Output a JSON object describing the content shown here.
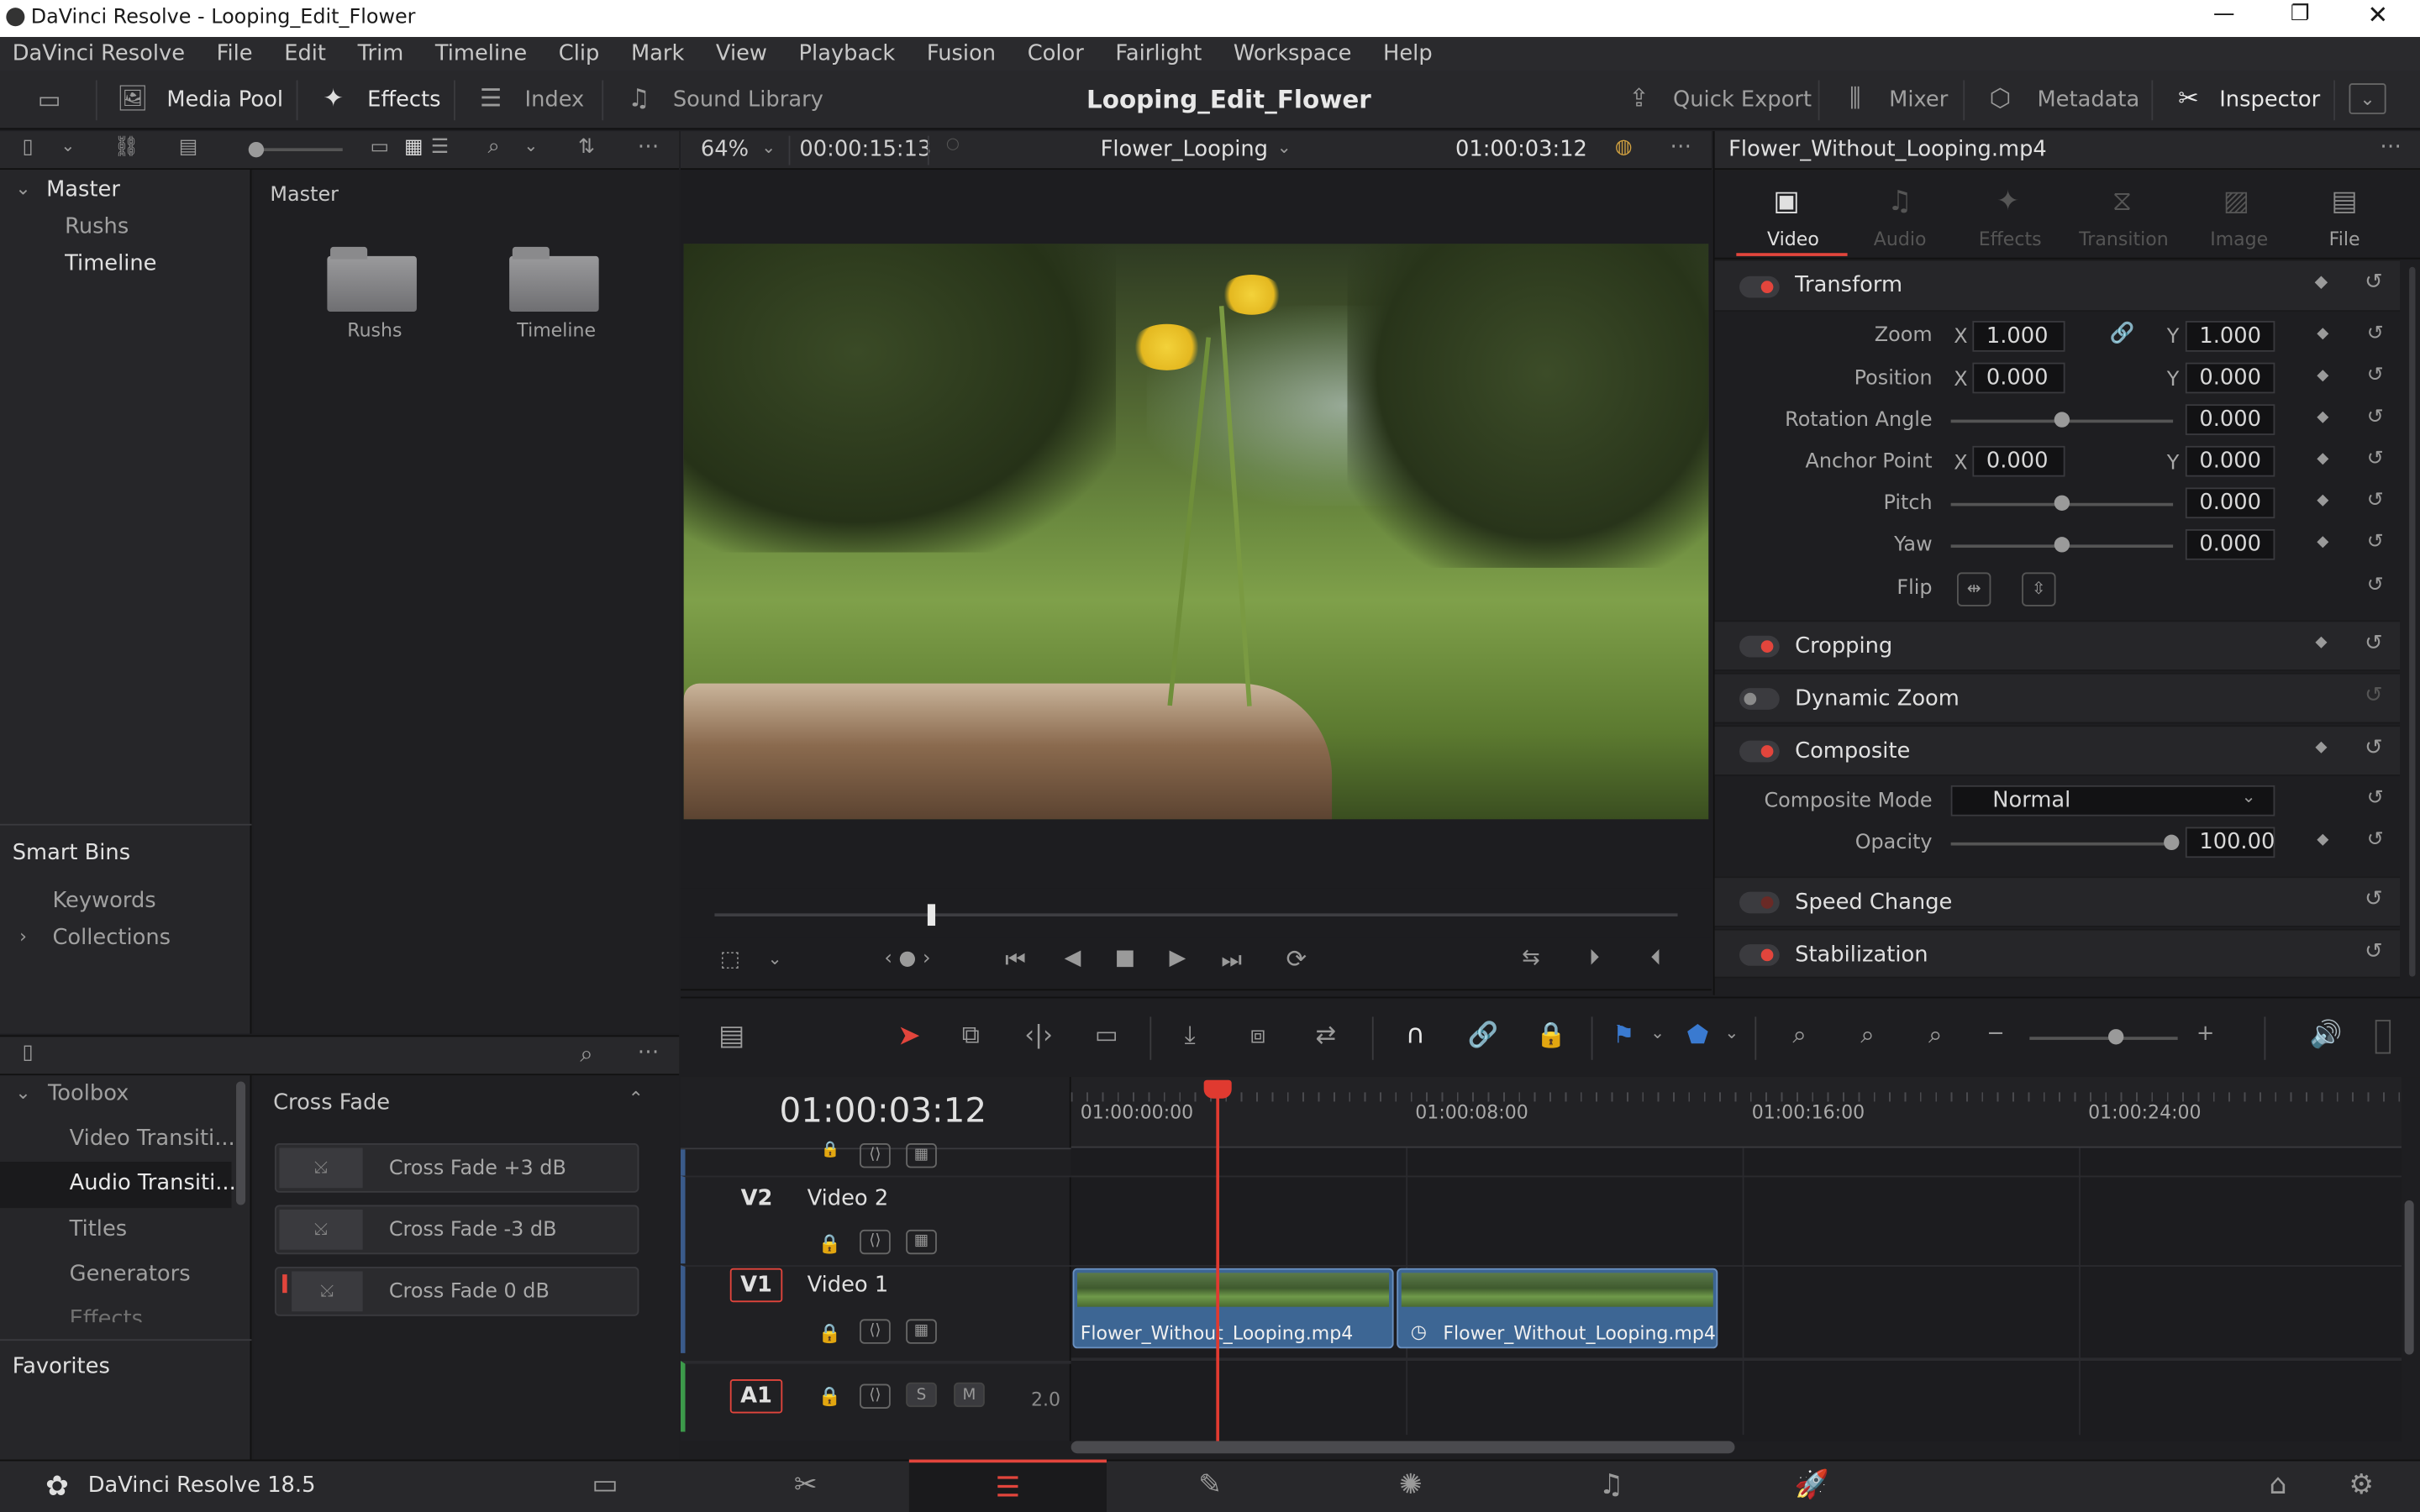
{
  "window": {
    "title": "DaVinci Resolve - Looping_Edit_Flower"
  },
  "menu": [
    "DaVinci Resolve",
    "File",
    "Edit",
    "Trim",
    "Timeline",
    "Clip",
    "Mark",
    "View",
    "Playback",
    "Fusion",
    "Color",
    "Fairlight",
    "Workspace",
    "Help"
  ],
  "toolbar": {
    "media_pool": "Media Pool",
    "effects": "Effects",
    "index": "Index",
    "sound_library": "Sound Library",
    "project_title": "Looping_Edit_Flower",
    "quick_export": "Quick Export",
    "mixer": "Mixer",
    "metadata": "Metadata",
    "inspector": "Inspector"
  },
  "viewer_bar": {
    "zoom": "64%",
    "duration": "00:00:15:13",
    "timeline_name": "Flower_Looping",
    "timecode": "01:00:03:12"
  },
  "bins": {
    "master": "Master",
    "items": [
      "Rushs",
      "Timeline"
    ],
    "header": "Master",
    "folders": [
      "Rushs",
      "Timeline"
    ],
    "smart_bins": "Smart Bins",
    "smart_items": [
      "Keywords",
      "Collections"
    ]
  },
  "effects_panel": {
    "toolbox": "Toolbox",
    "categories": [
      "Video Transiti...",
      "Audio Transiti...",
      "Titles",
      "Generators",
      "Effects"
    ],
    "favorites": "Favorites",
    "list_title": "Cross Fade",
    "items": [
      "Cross Fade +3 dB",
      "Cross Fade -3 dB",
      "Cross Fade 0 dB"
    ]
  },
  "inspector": {
    "clip_name": "Flower_Without_Looping.mp4",
    "tabs": [
      "Video",
      "Audio",
      "Effects",
      "Transition",
      "Image",
      "File"
    ],
    "transform": "Transform",
    "zoom_label": "Zoom",
    "zoom_x": "1.000",
    "zoom_y": "1.000",
    "position_label": "Position",
    "position_x": "0.000",
    "position_y": "0.000",
    "rotation_label": "Rotation Angle",
    "rotation": "0.000",
    "anchor_label": "Anchor Point",
    "anchor_x": "0.000",
    "anchor_y": "0.000",
    "pitch_label": "Pitch",
    "pitch": "0.000",
    "yaw_label": "Yaw",
    "yaw": "0.000",
    "flip_label": "Flip",
    "x": "X",
    "y": "Y",
    "cropping": "Cropping",
    "dynamic_zoom": "Dynamic Zoom",
    "composite": "Composite",
    "composite_mode_label": "Composite Mode",
    "composite_mode": "Normal",
    "opacity_label": "Opacity",
    "opacity": "100.00",
    "speed_change": "Speed Change",
    "stabilization": "Stabilization"
  },
  "timeline": {
    "timecode": "01:00:03:12",
    "ruler": [
      "01:00:00:00",
      "01:00:08:00",
      "01:00:16:00",
      "01:00:24:00"
    ],
    "tracks": [
      {
        "id": "V2",
        "name": "Video 2"
      },
      {
        "id": "V1",
        "name": "Video 1"
      },
      {
        "id": "A1",
        "name": "",
        "channels": "2.0"
      }
    ],
    "solo": "S",
    "mute": "M",
    "clips": [
      "Flower_Without_Looping.mp4",
      "Flower_Without_Looping.mp4"
    ]
  },
  "footer": {
    "app": "DaVinci Resolve 18.5"
  },
  "colors": {
    "accent_red": "#e2453c",
    "clip_blue": "#3d6694",
    "playhead": "#e03a30"
  }
}
